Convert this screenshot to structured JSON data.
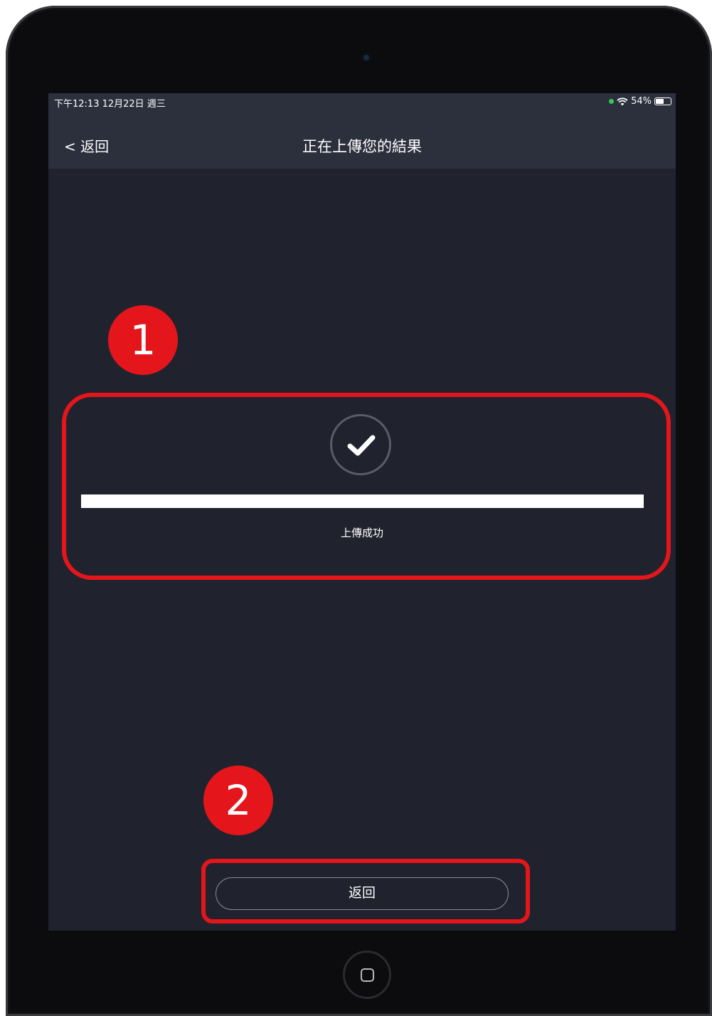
{
  "status_bar": {
    "time_date": "下午12:13   12月22日 週三",
    "battery": "54%",
    "battery_level": 0.54
  },
  "nav": {
    "back_label": "< 返回",
    "title": "正在上傳您的結果"
  },
  "upload": {
    "status_text": "上傳成功",
    "progress_percent": 100,
    "icon": "checkmark-icon"
  },
  "footer": {
    "return_label": "返回"
  },
  "annotations": {
    "marker_1": "1",
    "marker_2": "2",
    "highlight_color": "#e4161b"
  }
}
